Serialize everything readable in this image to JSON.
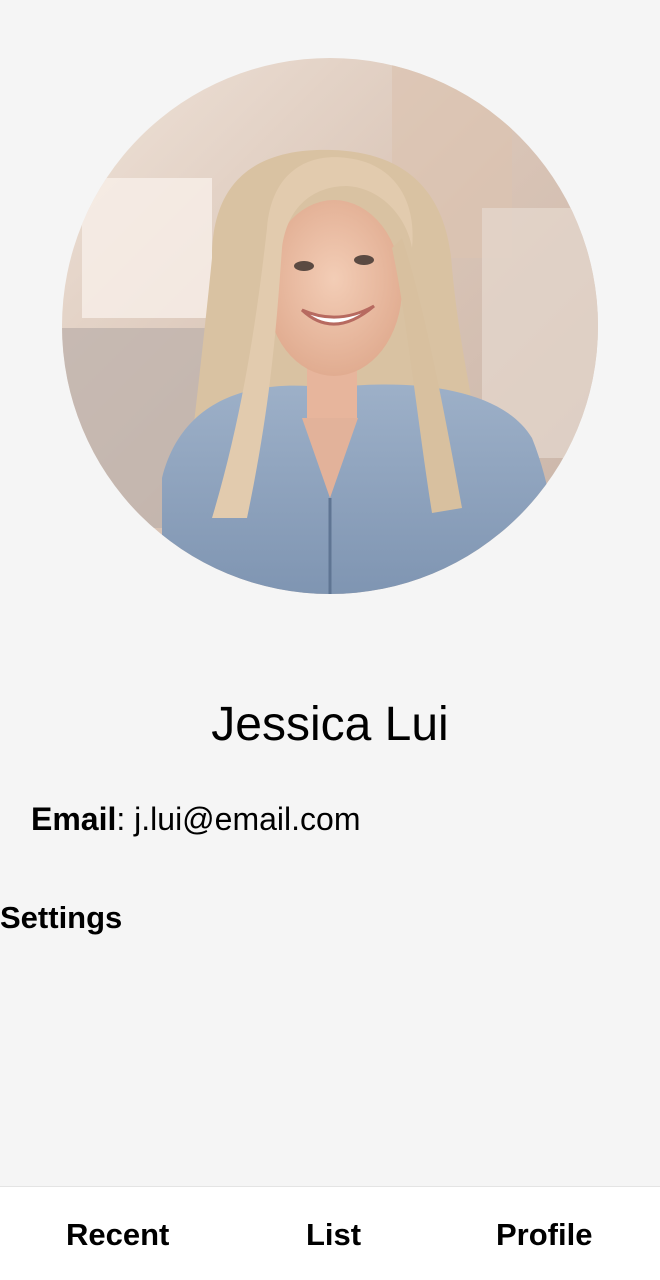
{
  "profile": {
    "name": "Jessica Lui",
    "email_label": "Email",
    "email_separator": ": ",
    "email": "j.lui@email.com",
    "settings_label": "Settings"
  },
  "tabs": [
    {
      "label": "Recent"
    },
    {
      "label": "List"
    },
    {
      "label": "Profile"
    }
  ],
  "colors": {
    "background": "#f5f5f5",
    "tabbar": "#ffffff",
    "text": "#000000"
  }
}
